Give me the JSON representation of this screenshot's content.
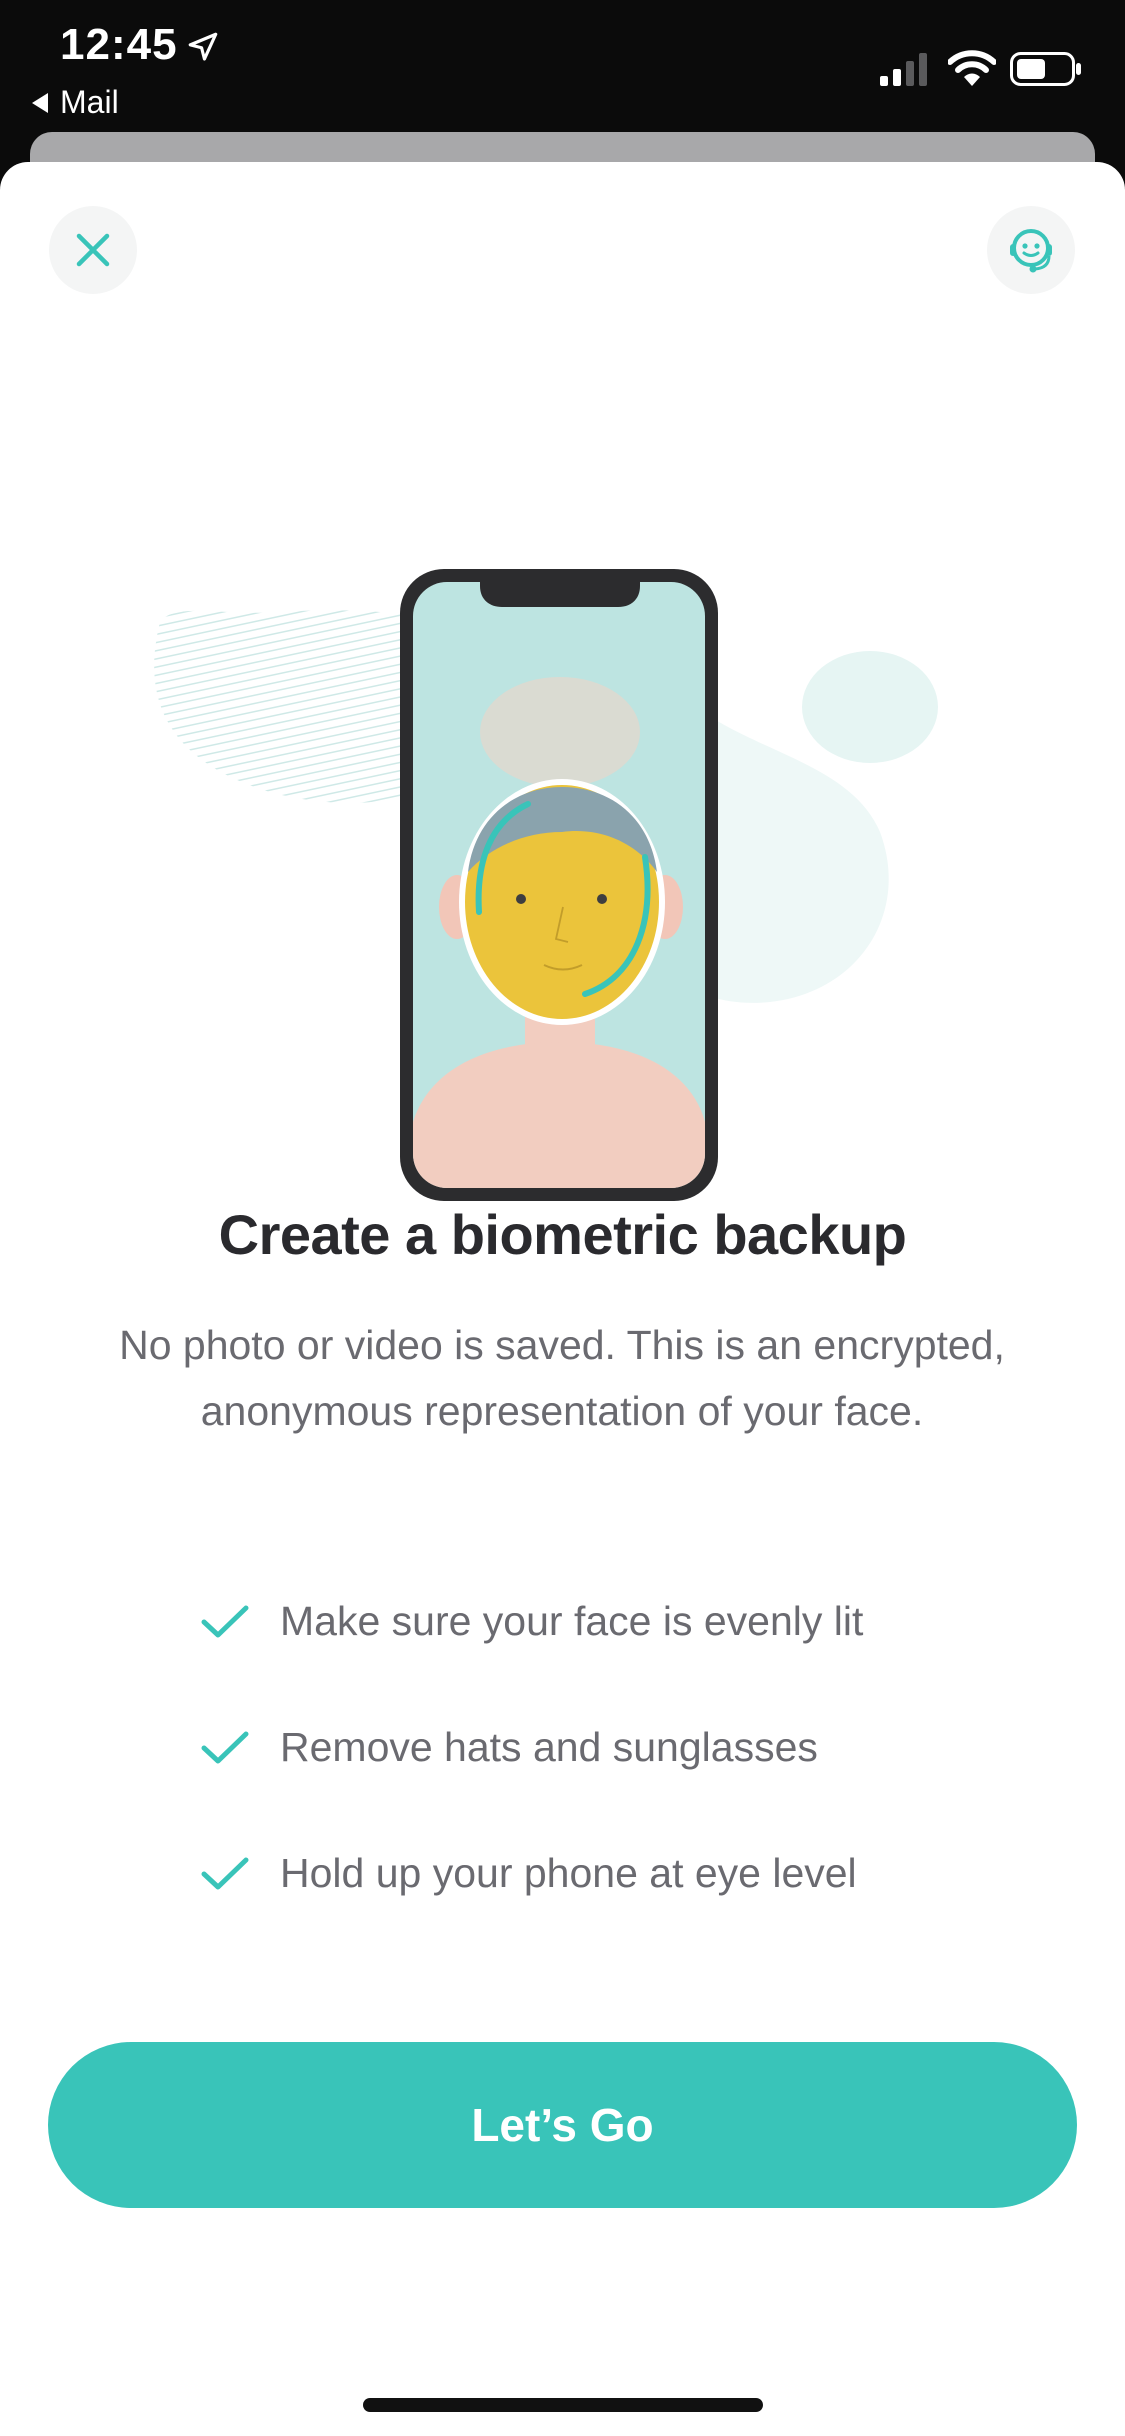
{
  "status_bar": {
    "time": "12:45",
    "back_app": "Mail",
    "location_icon": "location-arrow-icon",
    "signal_icon": "cellular-signal-icon",
    "wifi_icon": "wifi-icon",
    "battery_icon": "battery-icon"
  },
  "header": {
    "close_icon": "close-icon",
    "support_icon": "support-agent-icon"
  },
  "content": {
    "title": "Create a biometric backup",
    "description": "No photo or video is saved. This is an encrypted, anonymous representation of your face.",
    "tips": [
      "Make sure your face is evenly lit",
      "Remove hats and sunglasses",
      "Hold up your phone at eye level"
    ]
  },
  "cta": {
    "label": "Let’s Go"
  },
  "colors": {
    "accent": "#39c4b9",
    "title": "#2a2a2e",
    "body_text": "#6a6a70",
    "screen_bg": "#bde4e1",
    "face": "#ebc43b"
  }
}
